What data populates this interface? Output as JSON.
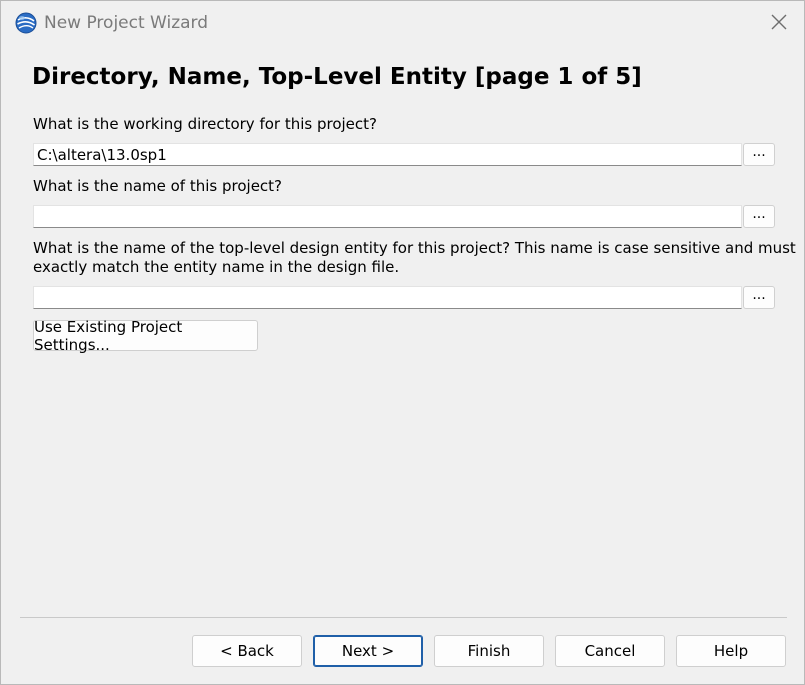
{
  "window": {
    "title": "New Project Wizard",
    "icon": "globe-icon"
  },
  "page": {
    "heading": "Directory, Name, Top-Level Entity [page 1 of 5]"
  },
  "fields": {
    "directory": {
      "label": "What is the working directory for this project?",
      "value": "C:\\altera\\13.0sp1",
      "browse_label": "..."
    },
    "project_name": {
      "label": "What is the name of this project?",
      "value": "",
      "browse_label": "..."
    },
    "top_level": {
      "label_line1": "What is the name of the top-level design entity for this project? This name is case sensitive and must",
      "label_line2": "exactly match the entity name in the design file.",
      "value": "",
      "browse_label": "..."
    }
  },
  "buttons": {
    "use_existing": "Use Existing Project Settings...",
    "back": "< Back",
    "next": "Next >",
    "finish": "Finish",
    "cancel": "Cancel",
    "help": "Help"
  },
  "colors": {
    "background": "#f0f0f0",
    "default_button_border": "#1f5fa8"
  }
}
